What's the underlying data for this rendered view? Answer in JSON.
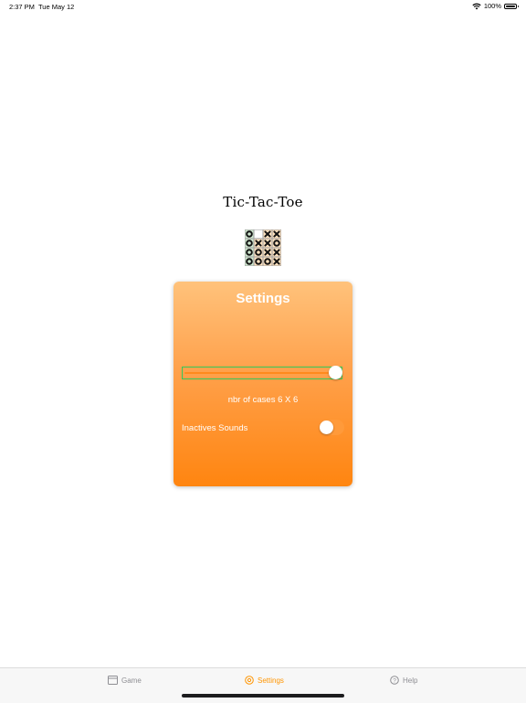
{
  "status_bar": {
    "time": "2:37 PM",
    "date": "Tue May 12",
    "battery_percent": "100%"
  },
  "app": {
    "title": "Tic-Tac-Toe"
  },
  "logo_board": [
    [
      "O",
      "",
      "X",
      "X"
    ],
    [
      "O",
      "X",
      "X",
      "O"
    ],
    [
      "O",
      "O",
      "X",
      "X"
    ],
    [
      "O",
      "O",
      "O",
      "X"
    ]
  ],
  "settings": {
    "title": "Settings",
    "slider_value_fraction": 1.0,
    "cases_label": "nbr of cases 6 X 6",
    "sounds_label": "Inactives Sounds",
    "sounds_toggle_on": false
  },
  "tabs": [
    {
      "label": "Game",
      "icon": "calendar-icon",
      "active": false
    },
    {
      "label": "Settings",
      "icon": "gear-icon",
      "active": true
    },
    {
      "label": "Help",
      "icon": "question-circle-icon",
      "active": false
    }
  ],
  "colors": {
    "accent": "#ff9500",
    "card_top": "#ffc27b",
    "card_bottom": "#ff8510",
    "slider_border": "#34c759"
  }
}
